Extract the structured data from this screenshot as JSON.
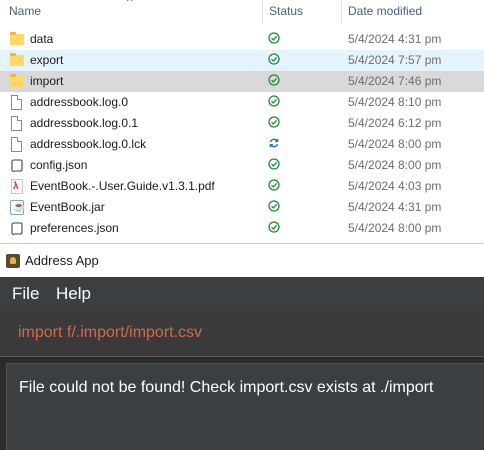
{
  "explorer": {
    "columns": {
      "name": "Name",
      "status": "Status",
      "date": "Date modified"
    },
    "collapse_glyph": "^",
    "files": [
      {
        "name": "data",
        "icon": "folder-icon",
        "status": "synced",
        "date": "5/4/2024 4:31 pm"
      },
      {
        "name": "export",
        "icon": "folder-icon",
        "status": "synced",
        "date": "5/4/2024 7:57 pm"
      },
      {
        "name": "import",
        "icon": "folder-icon",
        "status": "synced",
        "date": "5/4/2024 7:46 pm"
      },
      {
        "name": "addressbook.log.0",
        "icon": "document-icon",
        "status": "synced",
        "date": "5/4/2024 8:10 pm"
      },
      {
        "name": "addressbook.log.0.1",
        "icon": "document-icon",
        "status": "synced",
        "date": "5/4/2024 6:12 pm"
      },
      {
        "name": "addressbook.log.0.lck",
        "icon": "document-icon",
        "status": "syncing",
        "date": "5/4/2024 8:00 pm"
      },
      {
        "name": "config.json",
        "icon": "script-icon",
        "status": "synced",
        "date": "5/4/2024 8:00 pm"
      },
      {
        "name": "EventBook.-.User.Guide.v1.3.1.pdf",
        "icon": "pdf-icon",
        "status": "synced",
        "date": "5/4/2024 4:03 pm"
      },
      {
        "name": "EventBook.jar",
        "icon": "jar-icon",
        "status": "synced",
        "date": "5/4/2024 4:31 pm"
      },
      {
        "name": "preferences.json",
        "icon": "script-icon",
        "status": "synced",
        "date": "5/4/2024 8:00 pm"
      }
    ],
    "status_colors": {
      "synced": "#1f8a3a",
      "syncing": "#1f6fc9"
    }
  },
  "app": {
    "title": "Address App",
    "menu": {
      "file": "File",
      "help": "Help"
    },
    "command": "import f/.import/import.csv",
    "result": "File could not be found! Check import.csv exists at ./import"
  }
}
